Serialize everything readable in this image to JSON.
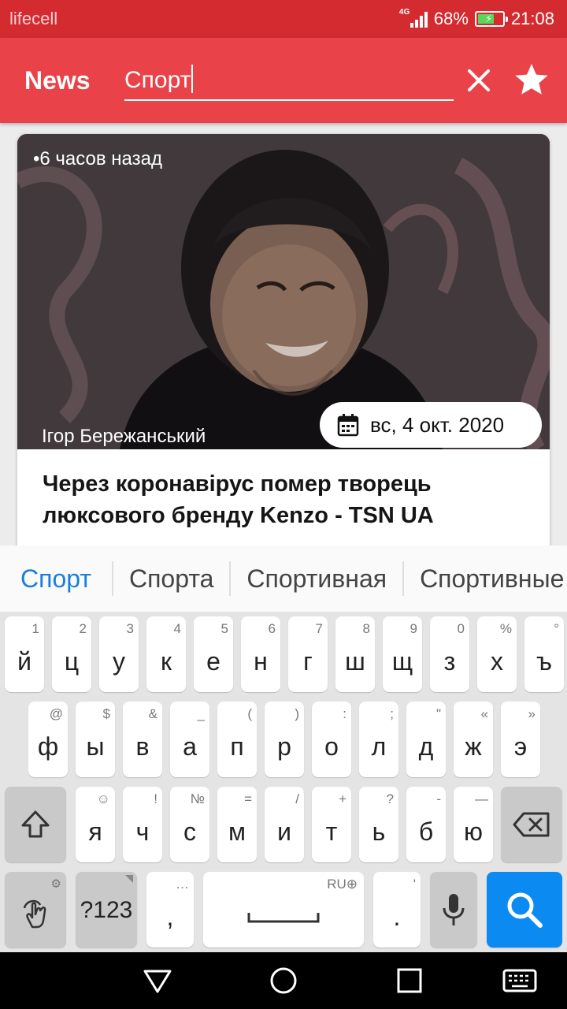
{
  "status_bar": {
    "carrier": "lifecell",
    "network": "4G",
    "battery": "68%",
    "battery_level": 0.68,
    "time": "21:08"
  },
  "app_bar": {
    "title": "News",
    "search_value": "Спорт",
    "clear_icon": "close-icon",
    "favorite_icon": "star-icon"
  },
  "card": {
    "time_ago": "•6 часов назад",
    "author": "Ігор Бережанський",
    "date": "вс, 4 окт. 2020",
    "title": "Через коронавірус помер творець люксового бренду Kenzo - TSN UA"
  },
  "suggestions": [
    "Спорт",
    "Спорта",
    "Спортивная",
    "Спортивные"
  ],
  "keyboard": {
    "row1": [
      {
        "key": "й",
        "sec": "1"
      },
      {
        "key": "ц",
        "sec": "2"
      },
      {
        "key": "у",
        "sec": "3"
      },
      {
        "key": "к",
        "sec": "4"
      },
      {
        "key": "е",
        "sec": "5"
      },
      {
        "key": "н",
        "sec": "6"
      },
      {
        "key": "г",
        "sec": "7"
      },
      {
        "key": "ш",
        "sec": "8"
      },
      {
        "key": "щ",
        "sec": "9"
      },
      {
        "key": "з",
        "sec": "0"
      },
      {
        "key": "х",
        "sec": "%"
      },
      {
        "key": "ъ",
        "sec": "°"
      }
    ],
    "row2": [
      {
        "key": "ф",
        "sec": "@"
      },
      {
        "key": "ы",
        "sec": "$"
      },
      {
        "key": "в",
        "sec": "&"
      },
      {
        "key": "а",
        "sec": "_"
      },
      {
        "key": "п",
        "sec": "("
      },
      {
        "key": "р",
        "sec": ")"
      },
      {
        "key": "о",
        "sec": ":"
      },
      {
        "key": "л",
        "sec": ";"
      },
      {
        "key": "д",
        "sec": "\""
      },
      {
        "key": "ж",
        "sec": "«"
      },
      {
        "key": "э",
        "sec": "»"
      }
    ],
    "row3": [
      {
        "key": "я",
        "sec": "☺"
      },
      {
        "key": "ч",
        "sec": "!"
      },
      {
        "key": "с",
        "sec": "№"
      },
      {
        "key": "м",
        "sec": "="
      },
      {
        "key": "и",
        "sec": "/"
      },
      {
        "key": "т",
        "sec": "+"
      },
      {
        "key": "ь",
        "sec": "?"
      },
      {
        "key": "б",
        "sec": "-"
      },
      {
        "key": "ю",
        "sec": "—"
      }
    ],
    "shift_icon": "shift-icon",
    "backspace_icon": "backspace-icon",
    "gesture_icon": "swipe-gesture-icon",
    "symbols_label": "?123",
    "comma_key": ",",
    "comma_sec": "…",
    "space_lang": "RU",
    "period_key": ".",
    "period_sec": "'",
    "mic_icon": "microphone-icon",
    "search_icon": "search-icon"
  },
  "nav_bar": {
    "back_icon": "back-triangle-icon",
    "home_icon": "home-circle-icon",
    "recents_icon": "recents-square-icon",
    "keyboard_icon": "keyboard-icon"
  },
  "colors": {
    "status_bar": "#d42b31",
    "app_bar": "#e94349",
    "accent_blue": "#0b8af2",
    "suggestion_active": "#1a7ee0"
  }
}
